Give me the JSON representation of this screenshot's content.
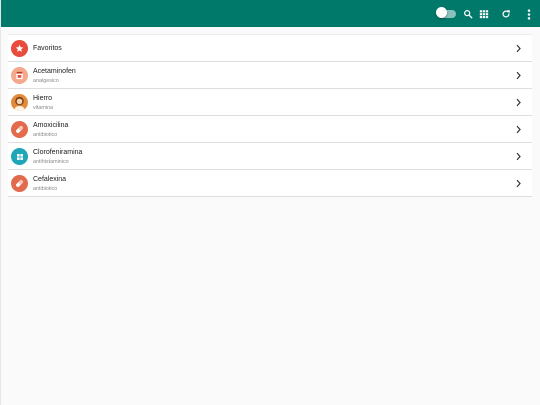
{
  "favorites": {
    "label": "Favoritos"
  },
  "items": [
    {
      "name": "Acetaminofen",
      "category": "analgesico"
    },
    {
      "name": "Hierro",
      "category": "vitamina"
    },
    {
      "name": "Amoxicilina",
      "category": "antibiotico"
    },
    {
      "name": "Clorofeniramina",
      "category": "antihistaminico"
    },
    {
      "name": "Cefalexina",
      "category": "antibiotico"
    }
  ],
  "colors": {
    "appbar": "#00796b",
    "favorites_badge": "#e74c3c",
    "antibiotic_badge": "#e26a4d",
    "antihistamine_badge": "#1fa7b8",
    "analgesic_badge": "#f2a98c",
    "vitamin_badge": "#e28c3a"
  },
  "icons": {
    "toggle": "toggle-switch-icon",
    "search": "search-icon",
    "grid": "grid-view-icon",
    "refresh": "refresh-icon",
    "more": "more-vert-icon",
    "row_chevron": "chevron-right-icon"
  }
}
